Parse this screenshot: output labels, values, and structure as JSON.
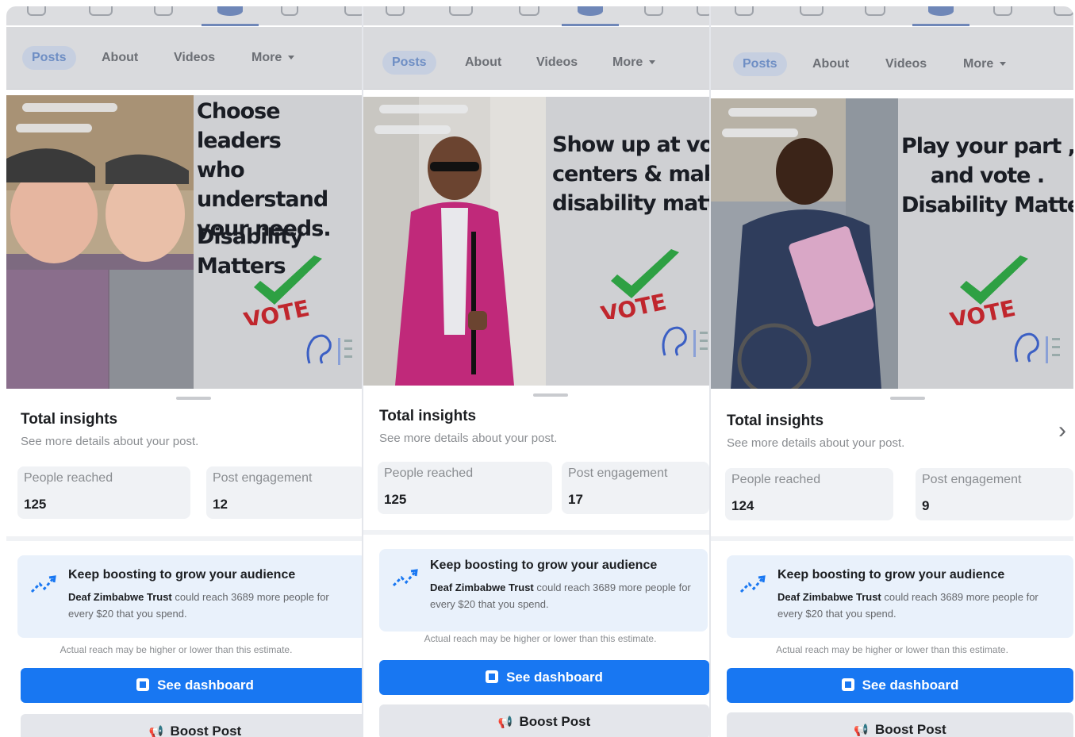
{
  "tabs": {
    "posts": "Posts",
    "about": "About",
    "videos": "Videos",
    "more": "More"
  },
  "posts": [
    {
      "headline": "Choose leaders\nwho understand\nyour needs.",
      "subline": "Disability Matters",
      "vote_word": "VOTE",
      "insights": {
        "title": "Total insights",
        "subtitle": "See more details about your post.",
        "people_reached_label": "People reached",
        "people_reached": "125",
        "engagement_label": "Post engagement",
        "engagement": "12"
      }
    },
    {
      "headline": "Show up at voting\ncenters & make\ndisability matter",
      "vote_word": "VOTE",
      "insights": {
        "title": "Total insights",
        "subtitle": "See more details about your post.",
        "people_reached_label": "People reached",
        "people_reached": "125",
        "engagement_label": "Post engagement",
        "engagement": "17"
      }
    },
    {
      "headline": "Play your part , Go\nand vote .\nDisability Matters",
      "vote_word": "VOTE",
      "insights": {
        "title": "Total insights",
        "subtitle": "See more details about your post.",
        "people_reached_label": "People reached",
        "people_reached": "124",
        "engagement_label": "Post engagement",
        "engagement": "9"
      }
    }
  ],
  "boost": {
    "title": "Keep boosting to grow your audience",
    "org": "Deaf Zimbabwe Trust",
    "body": " could reach 3689 more people for every $20 that you spend.",
    "estimate_note": "Actual reach may be higher or lower than this estimate."
  },
  "buttons": {
    "dashboard": "See dashboard",
    "boost_post": "Boost Post"
  },
  "colors": {
    "primary": "#1877f2",
    "boost_card_bg": "#e9f1fb",
    "vote_check": "#2ea043",
    "vote_text": "#c0262d"
  }
}
